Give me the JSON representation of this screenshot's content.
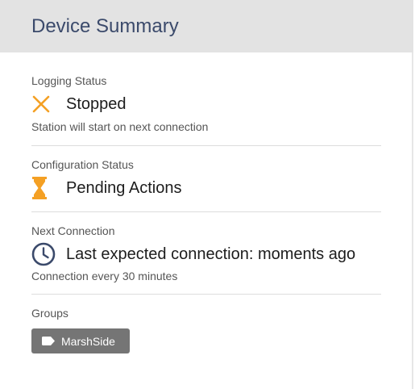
{
  "card": {
    "title": "Device Summary"
  },
  "logging": {
    "label": "Logging Status",
    "status": "Stopped",
    "detail": "Station will start on next connection",
    "icon": "close-icon",
    "icon_color": "#f4a024"
  },
  "configuration": {
    "label": "Configuration Status",
    "status": "Pending Actions",
    "icon": "hourglass-icon",
    "icon_color": "#f4a024"
  },
  "connection": {
    "label": "Next Connection",
    "status": "Last expected connection: moments ago",
    "detail": "Connection every 30 minutes",
    "icon": "clock-icon",
    "icon_color": "#3b4a6b"
  },
  "groups": {
    "label": "Groups",
    "items": [
      {
        "name": "MarshSide",
        "icon": "tag-icon"
      }
    ]
  }
}
